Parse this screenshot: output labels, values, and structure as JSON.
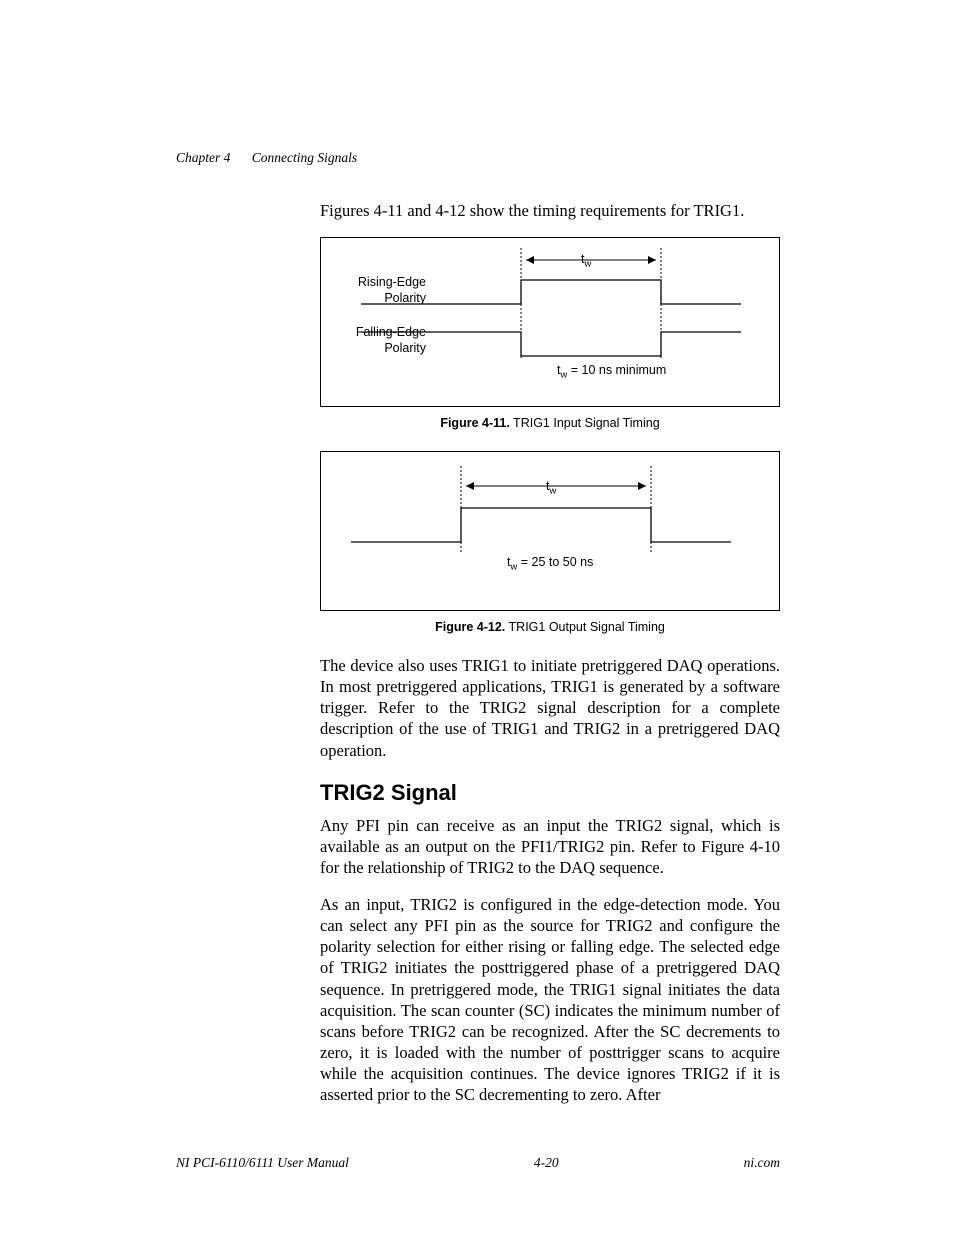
{
  "header": {
    "chapter": "Chapter 4",
    "title": "Connecting Signals"
  },
  "intro_para": "Figures 4-11 and 4-12 show the timing requirements for TRIG1.",
  "fig411": {
    "label_rise_l1": "Rising-Edge",
    "label_rise_l2": "Polarity",
    "label_fall_l1": "Falling-Edge",
    "label_fall_l2": "Polarity",
    "tw_label": "t",
    "tw_sub": "w",
    "timing_text": "t",
    "timing_sub": "w",
    "timing_rest": " = 10 ns minimum",
    "caption_bold": "Figure 4-11.",
    "caption_rest": "  TRIG1 Input Signal Timing"
  },
  "fig412": {
    "tw_label": "t",
    "tw_sub": "w",
    "timing_text": "t",
    "timing_sub": "w",
    "timing_rest": " = 25 to 50 ns",
    "caption_bold": "Figure 4-12.",
    "caption_rest": "  TRIG1 Output Signal Timing"
  },
  "para_after_figs": "The device also uses TRIG1 to initiate pretriggered DAQ operations. In most pretriggered applications, TRIG1 is generated by a software trigger. Refer to the TRIG2 signal description for a complete description of the use of TRIG1 and TRIG2 in a pretriggered DAQ operation.",
  "section_heading": "TRIG2 Signal",
  "para_trig2_1": "Any PFI pin can receive as an input the TRIG2 signal, which is available as an output on the PFI1/TRIG2 pin. Refer to Figure 4-10 for the relationship of TRIG2 to the DAQ sequence.",
  "para_trig2_2": "As an input, TRIG2 is configured in the edge-detection mode. You can select any PFI pin as the source for TRIG2 and configure the polarity selection for either rising or falling edge. The selected edge of TRIG2 initiates the posttriggered phase of a pretriggered DAQ sequence. In pretriggered mode, the TRIG1 signal initiates the data acquisition. The scan counter (SC) indicates the minimum number of scans before TRIG2 can be recognized. After the SC decrements to zero, it is loaded with the number of posttrigger scans to acquire while the acquisition continues. The device ignores TRIG2 if it is asserted prior to the SC decrementing to zero. After",
  "footer": {
    "left": "NI PCI-6110/6111 User Manual",
    "center": "4-20",
    "right": "ni.com"
  }
}
